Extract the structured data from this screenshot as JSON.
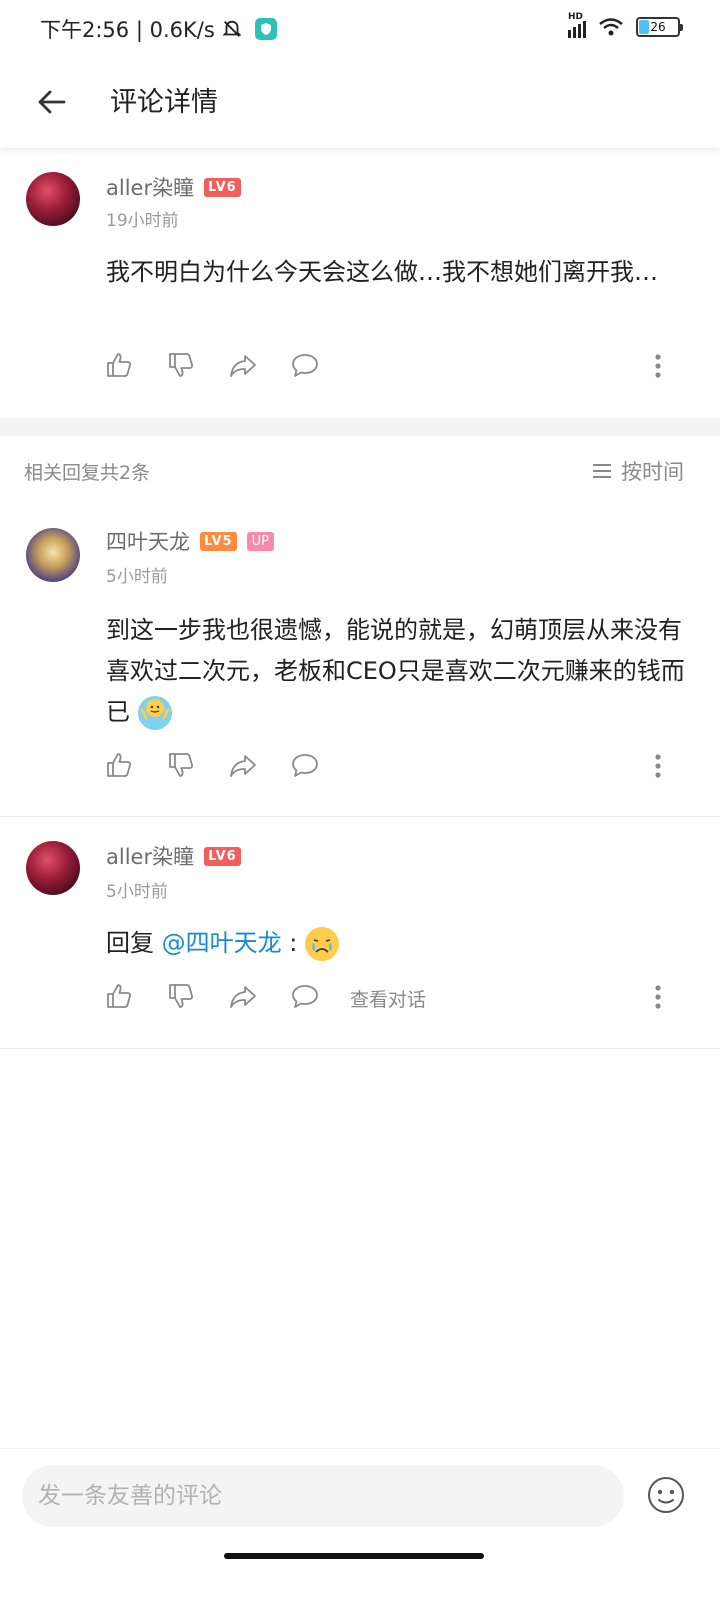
{
  "status_bar": {
    "time_speed": "下午2:56 | 0.6K/s",
    "battery": "26",
    "network": "HD"
  },
  "header": {
    "title": "评论详情"
  },
  "main_comment": {
    "username": "aller染瞳",
    "level": "LV6",
    "time": "19小时前",
    "text": "我不明白为什么今天会这么做…我不想她们离开我…"
  },
  "replies": {
    "count_label": "相关回复共2条",
    "sort_label": "按时间",
    "items": [
      {
        "username": "四叶天龙",
        "level": "LV5",
        "badge": "UP",
        "time": "5小时前",
        "text": "到这一步我也很遗憾，能说的就是，幻萌顶层从来没有喜欢过二次元，老板和CEO只是喜欢二次元赚来的钱而已"
      },
      {
        "username": "aller染瞳",
        "level": "LV6",
        "time": "5小时前",
        "reply_prefix": "回复 ",
        "mention": "@四叶天龙",
        "reply_suffix": " :",
        "view_conversation": "查看对话"
      }
    ]
  },
  "composer": {
    "placeholder": "发一条友善的评论"
  },
  "colors": {
    "level6": "#f25d5d",
    "level5": "#ff8a3d",
    "up_badge": "#f68aa8",
    "mention": "#178bcf"
  }
}
